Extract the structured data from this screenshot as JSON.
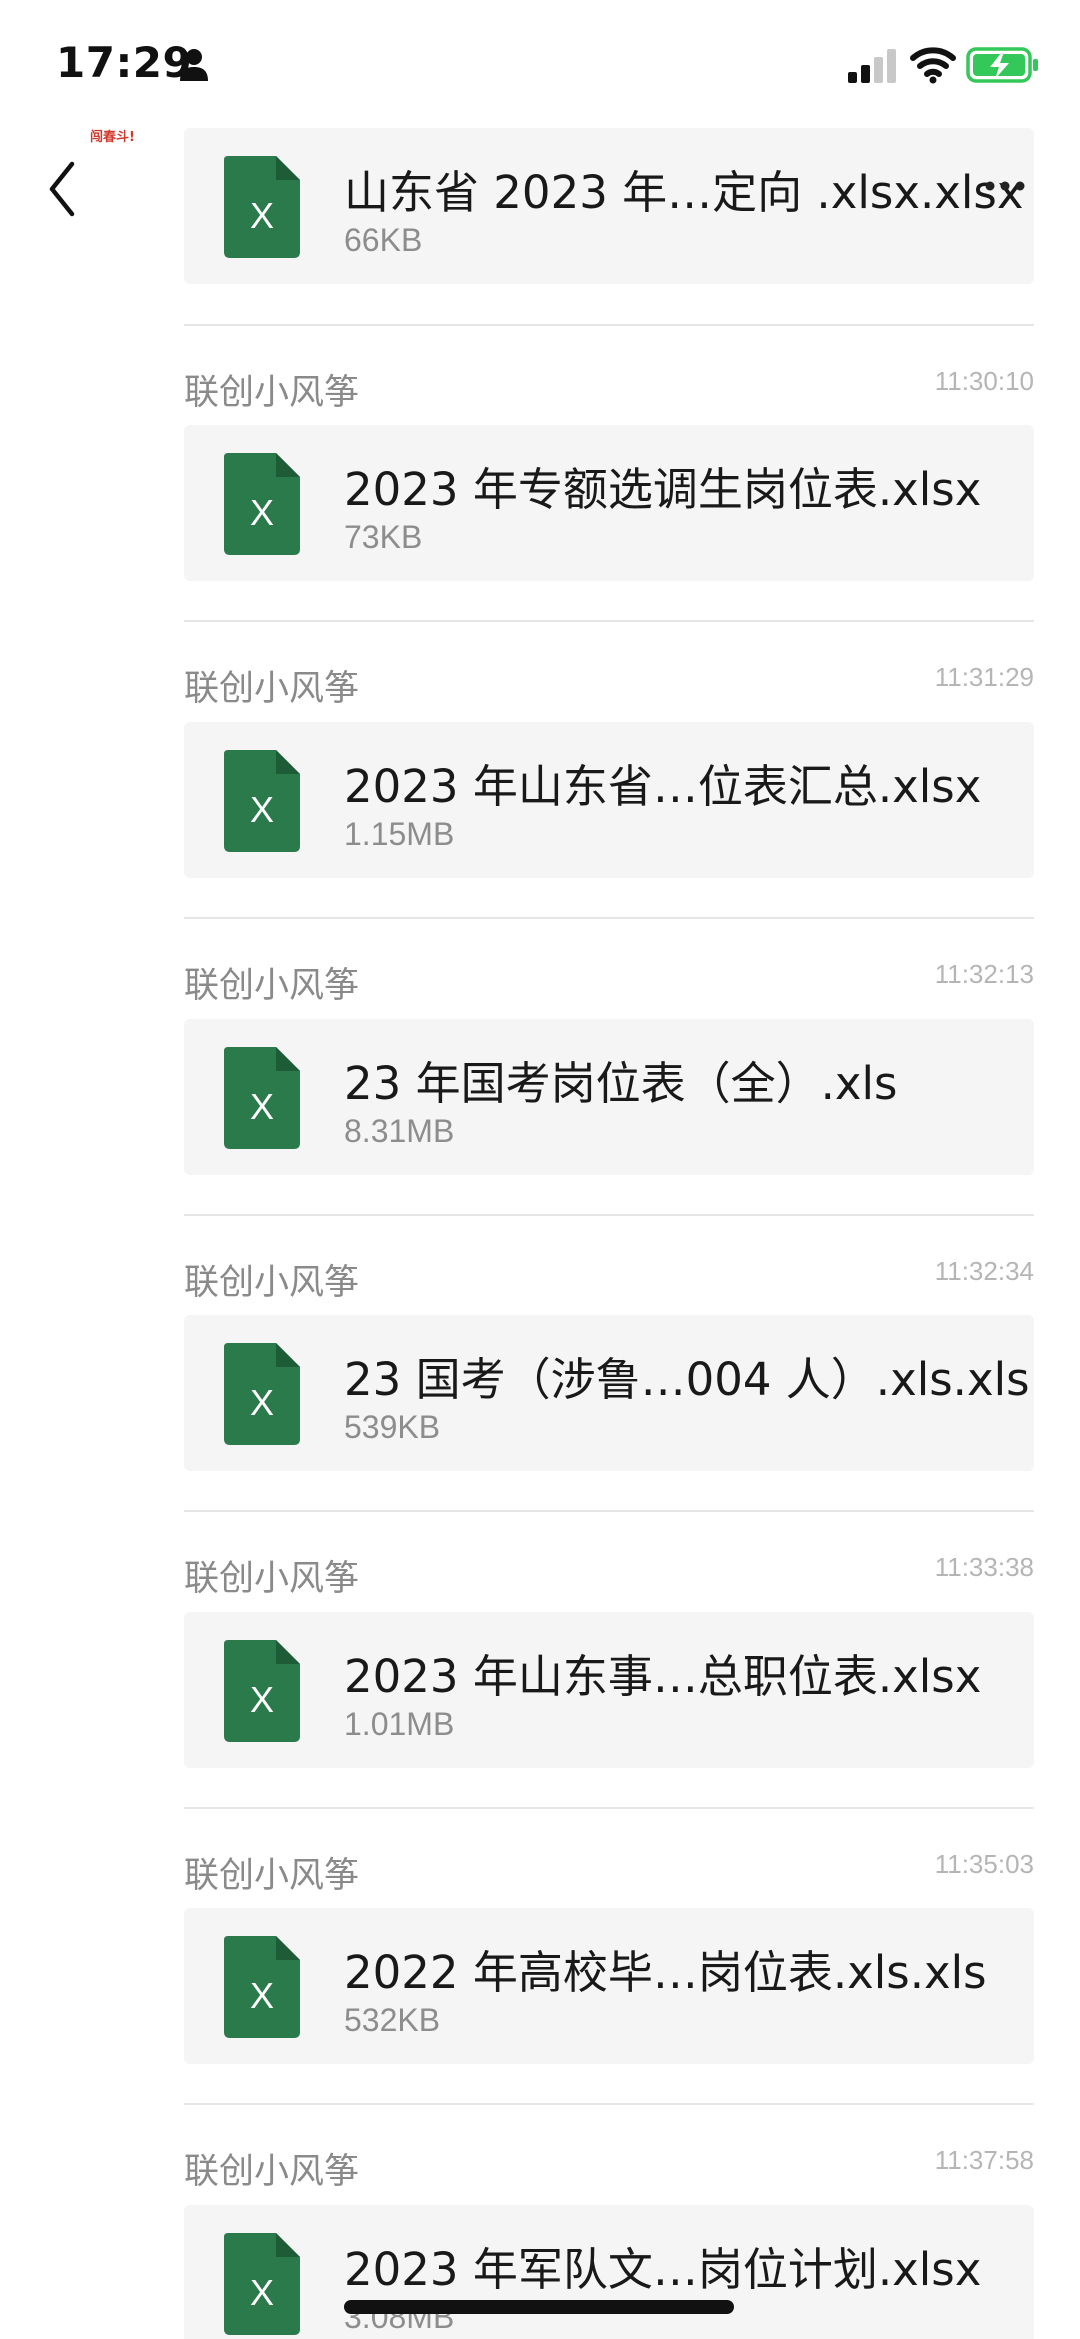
{
  "status_bar": {
    "time": "17:29",
    "icons": [
      "person-icon",
      "signal-icon",
      "wifi-icon",
      "battery-charging-icon"
    ],
    "battery_color": "#34c759"
  },
  "nav": {
    "back_icon": "chevron-left-icon",
    "avatar_text": "闯春斗!"
  },
  "accent": {
    "excel_green": "#2a7a4b",
    "card_bg": "#f5f5f5"
  },
  "records": [
    {
      "sender": "",
      "time": "",
      "file_name": "山东省 2023 年…定向 .xlsx.xlsx",
      "file_size": "66KB"
    },
    {
      "sender": "联创小风筝",
      "time": "11:30:10",
      "file_name": "2023 年专额选调生岗位表.xlsx",
      "file_size": "73KB"
    },
    {
      "sender": "联创小风筝",
      "time": "11:31:29",
      "file_name": "2023 年山东省…位表汇总.xlsx",
      "file_size": "1.15MB"
    },
    {
      "sender": "联创小风筝",
      "time": "11:32:13",
      "file_name": "23 年国考岗位表（全）.xls",
      "file_size": "8.31MB"
    },
    {
      "sender": "联创小风筝",
      "time": "11:32:34",
      "file_name": "23 国考（涉鲁…004 人）.xls.xls",
      "file_size": "539KB"
    },
    {
      "sender": "联创小风筝",
      "time": "11:33:38",
      "file_name": "2023 年山东事…总职位表.xlsx",
      "file_size": "1.01MB"
    },
    {
      "sender": "联创小风筝",
      "time": "11:35:03",
      "file_name": "2022 年高校毕…岗位表.xls.xls",
      "file_size": "532KB"
    },
    {
      "sender": "联创小风筝",
      "time": "11:37:58",
      "file_name": "2023 年军队文…岗位计划.xlsx",
      "file_size": "3.08MB"
    }
  ]
}
